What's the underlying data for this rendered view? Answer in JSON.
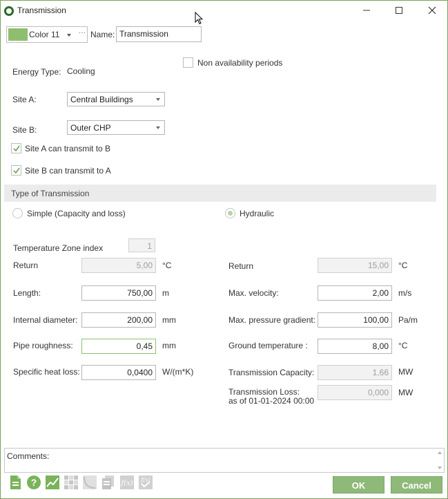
{
  "window": {
    "title": "Transmission"
  },
  "header": {
    "color_label": "Color 11",
    "color_swatch": "#8fbf6e",
    "more": "···",
    "name_label": "Name:",
    "name_value": "Transmission"
  },
  "non_availability": {
    "label": "Non availability periods",
    "checked": false
  },
  "energy_type": {
    "label": "Energy Type:",
    "value": "Cooling"
  },
  "site_a": {
    "label": "Site A:",
    "value": "Central Buildings"
  },
  "site_b": {
    "label": "Site B:",
    "value": "Outer CHP"
  },
  "transmit": {
    "a_to_b": {
      "label": "Site A can transmit to B",
      "checked": true
    },
    "b_to_a": {
      "label": "Site B can transmit to A",
      "checked": true
    }
  },
  "type_of_transmission": {
    "header": "Type of Transmission",
    "options": [
      {
        "label": "Simple (Capacity and loss)",
        "selected": false
      },
      {
        "label": "Hydraulic",
        "selected": true
      }
    ]
  },
  "temperature_zone": {
    "label": "Temperature Zone index",
    "value": "1"
  },
  "left_fields": {
    "return": {
      "label": "Return",
      "value": "5,00",
      "unit": "°C"
    },
    "length": {
      "label": "Length:",
      "value": "750,00",
      "unit": "m"
    },
    "internal_diameter": {
      "label": "Internal diameter:",
      "value": "200,00",
      "unit": "mm"
    },
    "pipe_roughness": {
      "label": "Pipe roughness:",
      "value": "0,45",
      "unit": "mm"
    },
    "specific_heat_loss": {
      "label": "Specific heat loss:",
      "value": "0,0400",
      "unit": "W/(m*K)"
    }
  },
  "right_fields": {
    "return": {
      "label": "Return",
      "value": "15,00",
      "unit": "°C"
    },
    "max_velocity": {
      "label": "Max. velocity:",
      "value": "2,00",
      "unit": "m/s"
    },
    "max_pressure_gradient": {
      "label": "Max. pressure gradient:",
      "value": "100,00",
      "unit": "Pa/m"
    },
    "ground_temperature": {
      "label": "Ground temperature :",
      "value": "8,00",
      "unit": "°C"
    },
    "transmission_capacity": {
      "label": "Transmission Capacity:",
      "value": "1,66",
      "unit": "MW"
    },
    "transmission_loss": {
      "label": "Transmission Loss:",
      "label2": "as of 01-01-2024 00:00",
      "value": "0,000",
      "unit": "MW"
    }
  },
  "comments": {
    "label": "Comments:"
  },
  "buttons": {
    "ok": "OK",
    "cancel": "Cancel"
  },
  "colors": {
    "accent": "#8fb978",
    "accent_border": "#7aa664",
    "check": "#5a9a3a"
  }
}
